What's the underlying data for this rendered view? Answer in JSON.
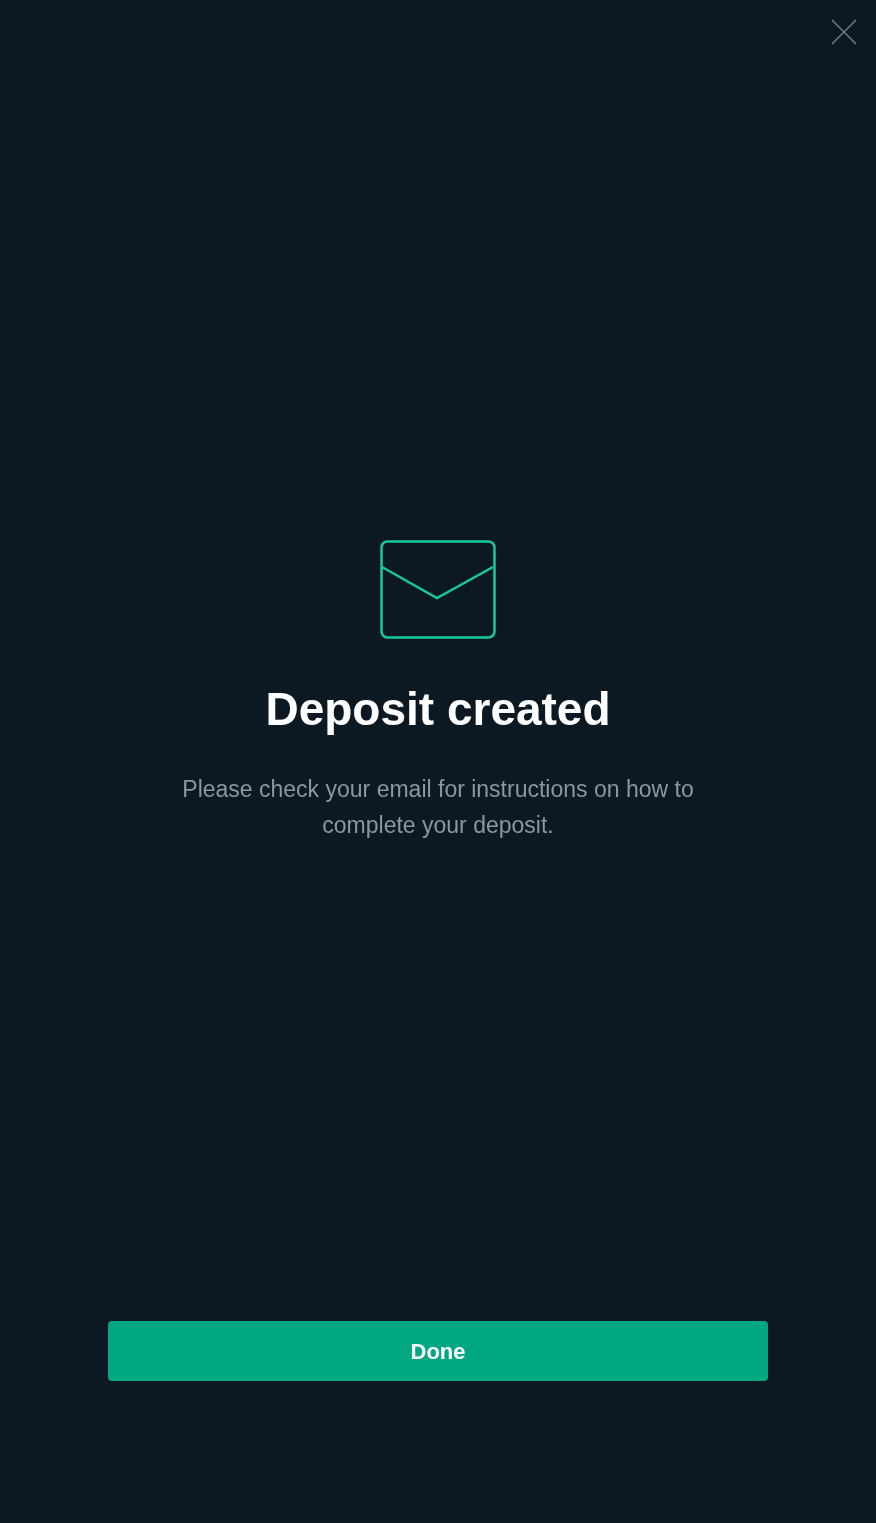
{
  "title": "Deposit created",
  "message": "Please check your email for instructions on how to complete your deposit.",
  "button": "Done"
}
